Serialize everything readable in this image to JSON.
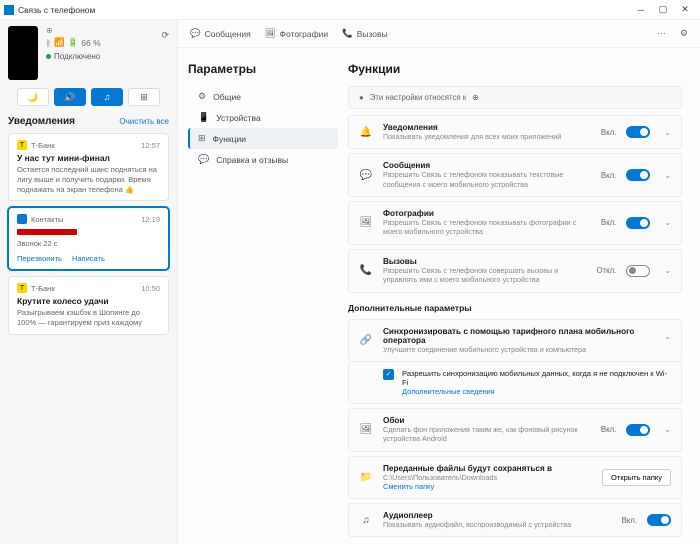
{
  "window": {
    "title": "Связь с телефоном"
  },
  "phone": {
    "model": "—",
    "battery": "66 %",
    "connected": "Подключено"
  },
  "notifications_hdr": "Уведомления",
  "clear_all": "Очистить все",
  "notifs": [
    {
      "app": "Т-Банк",
      "time": "12:57",
      "title": "У нас тут мини-финал",
      "body": "Остается последний шанс подняться на лигу выше и получить подарки. Время поднажать на экран телефона 👍"
    },
    {
      "app": "Контакты",
      "time": "12:19",
      "title": "",
      "body": "Звонок 22 с",
      "actions": [
        "Перезвонить",
        "Написать"
      ]
    },
    {
      "app": "Т-Банк",
      "time": "10:50",
      "title": "Крутите колесо удачи",
      "body": "Разыгрываем кэшбэк в Шопинге до 100% — гарантируем приз каждому"
    }
  ],
  "topbar": {
    "messages": "Сообщения",
    "photos": "Фотографии",
    "calls": "Вызовы"
  },
  "settings": {
    "heading": "Параметры",
    "items": [
      "Общие",
      "Устройства",
      "Функции",
      "Справка и отзывы"
    ]
  },
  "main": {
    "heading": "Функции",
    "info": "Эти настройки относятся к",
    "features": [
      {
        "title": "Уведомления",
        "desc": "Показывать уведомления для всех моих приложений",
        "state": "Вкл.",
        "on": true
      },
      {
        "title": "Сообщения",
        "desc": "Разрешить Связь с телефоном показывать текстовые сообщения с моего мобильного устройства",
        "state": "Вкл.",
        "on": true
      },
      {
        "title": "Фотографии",
        "desc": "Разрешить Связь с телефоном показывать фотографии с моего мобильного устройства",
        "state": "Вкл.",
        "on": true
      },
      {
        "title": "Вызовы",
        "desc": "Разрешить Связь с телефоном совершать вызовы и управлять ими с моего мобильного устройства",
        "state": "Откл.",
        "on": false
      }
    ],
    "more_hdr": "Дополнительные параметры",
    "sync": {
      "title": "Синхронизировать с помощью тарифного плана мобильного оператора",
      "desc": "Улучшите соединение мобильного устройства и компьютера",
      "check_label": "Разрешить синхронизацию мобильных данных, когда я не подключен к Wi-Fi",
      "more_link": "Дополнительные сведения"
    },
    "wallpaper": {
      "title": "Обои",
      "desc": "Сделать фон приложения таким же, как фоновый рисунок устройства Android",
      "state": "Вкл."
    },
    "files": {
      "title": "Переданные файлы будут сохраняться в",
      "path": "C:\\Users\\Пользователь\\Downloads",
      "change": "Сменить папку",
      "open": "Открыть папку"
    },
    "audio": {
      "title": "Аудиоплеер",
      "desc": "Показывать аудиофайл, воспроизводимый с устройства",
      "state": "Вкл."
    }
  }
}
